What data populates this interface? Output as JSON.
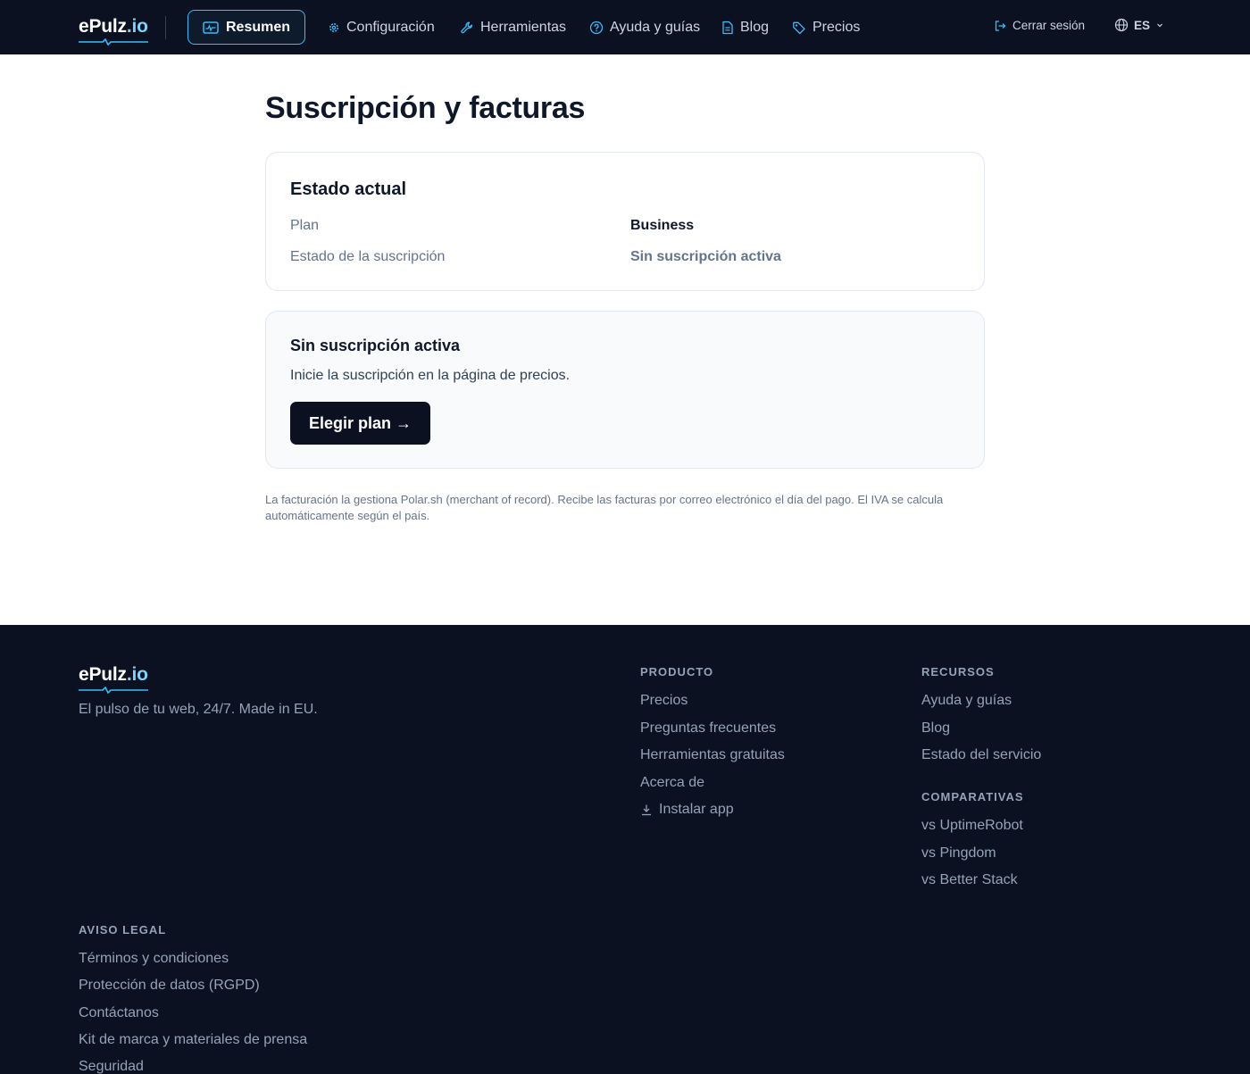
{
  "brand": {
    "name": "ePulz",
    "tld": ".io"
  },
  "nav": {
    "active_label": "Resumen",
    "items": [
      {
        "label": "Configuración",
        "icon": "gear-icon"
      },
      {
        "label": "Herramientas",
        "icon": "wrench-icon"
      },
      {
        "label": "Ayuda y guías",
        "icon": "help-circle-icon"
      },
      {
        "label": "Blog",
        "icon": "document-icon"
      },
      {
        "label": "Precios",
        "icon": "tag-icon"
      }
    ],
    "logout_label": "Cerrar sesión",
    "language": "ES"
  },
  "page": {
    "title": "Suscripción y facturas",
    "status_card": {
      "title": "Estado actual",
      "rows": [
        {
          "label": "Plan",
          "value": "Business"
        },
        {
          "label": "Estado de la suscripción",
          "value": "Sin suscripción activa"
        }
      ]
    },
    "empty_card": {
      "title": "Sin suscripción activa",
      "text": "Inicie la suscripción en la página de precios.",
      "button_label": "Elegir plan →"
    },
    "billing_note": "La facturación la gestiona Polar.sh (merchant of record). Recibe las facturas por correo electrónico el día del pago. El IVA se calcula automáticamente según el país."
  },
  "footer": {
    "tagline": "El pulso de tu web, 24/7. Made in EU.",
    "producto": {
      "title": "PRODUCTO",
      "links": [
        "Precios",
        "Preguntas frecuentes",
        "Herramientas gratuitas",
        "Acerca de",
        "Instalar app"
      ]
    },
    "recursos": {
      "title": "RECURSOS",
      "links": [
        "Ayuda y guías",
        "Blog",
        "Estado del servicio"
      ]
    },
    "comparativas": {
      "title": "COMPARATIVAS",
      "links": [
        "vs UptimeRobot",
        "vs Pingdom",
        "vs Better Stack"
      ]
    },
    "legal": {
      "title": "AVISO LEGAL",
      "links": [
        "Términos y condiciones",
        "Protección de datos (RGPD)",
        "Contáctanos",
        "Kit de marca y materiales de prensa",
        "Seguridad"
      ]
    }
  },
  "colors": {
    "nav_bg": "#0b1120",
    "accent": "#38bdf8",
    "text_primary": "#0f172a",
    "text_muted": "#64748b",
    "footer_link": "#94a3b8"
  }
}
